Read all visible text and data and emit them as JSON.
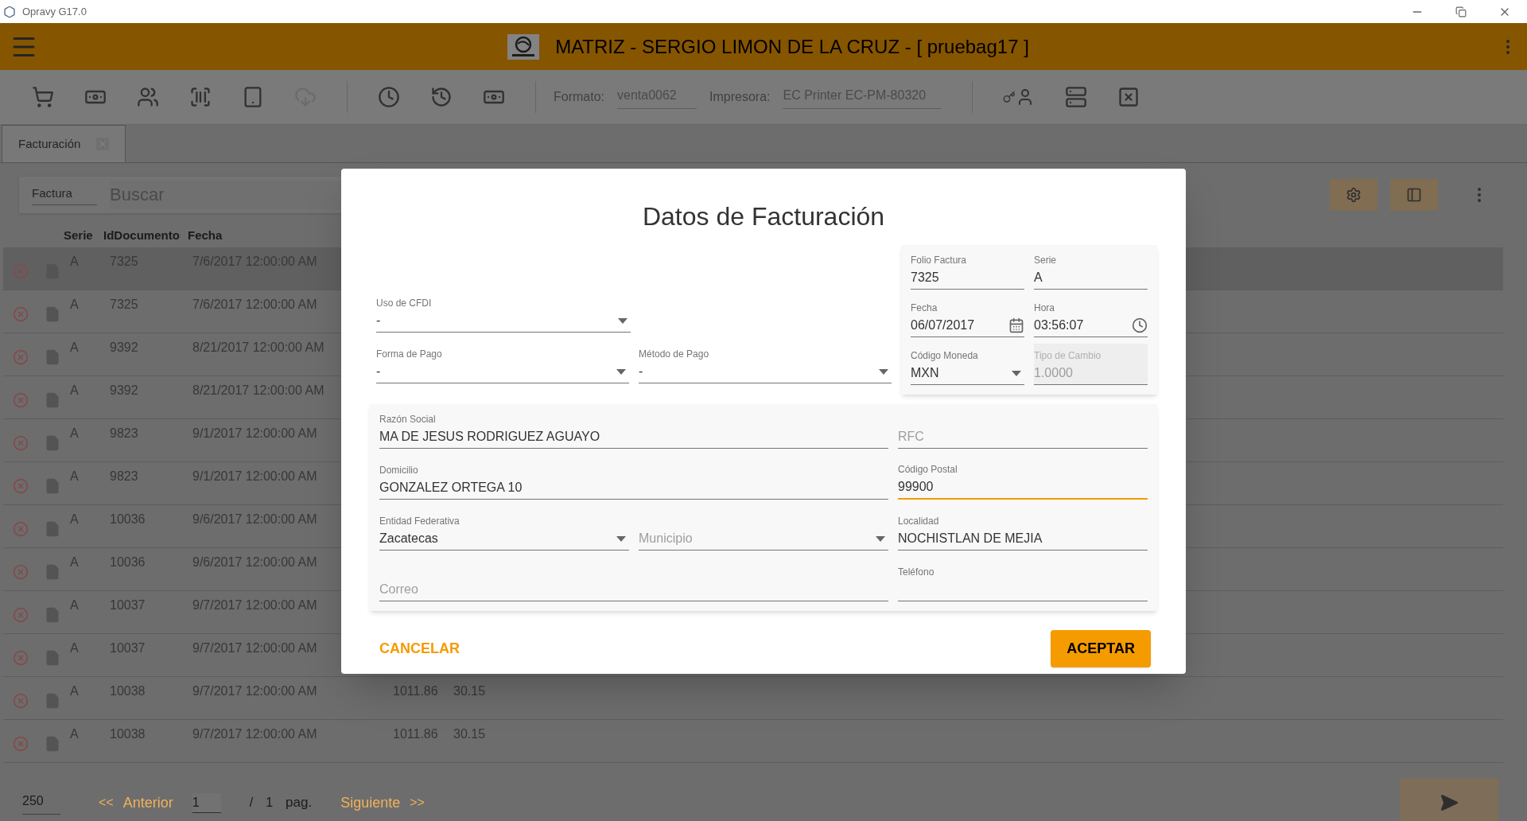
{
  "window": {
    "title": "Opravy G17.0"
  },
  "header": {
    "title": "MATRIZ - SERGIO LIMON DE LA CRUZ - [ pruebag17 ]"
  },
  "toolbar": {
    "icons": [
      {
        "kind": "cart",
        "disabled": false
      },
      {
        "kind": "cash",
        "disabled": false
      },
      {
        "kind": "people",
        "disabled": false
      },
      {
        "kind": "barcode",
        "disabled": false
      },
      {
        "kind": "tablet",
        "disabled": false
      },
      {
        "kind": "cloud",
        "disabled": true
      },
      {
        "kind": "clock",
        "disabled": false
      },
      {
        "kind": "history",
        "disabled": false
      },
      {
        "kind": "cash",
        "disabled": false
      }
    ],
    "format_label": "Formato:",
    "format_value": "venta0062",
    "printer_label": "Impresora:",
    "printer_value": "EC Printer EC-PM-80320",
    "right_icons": [
      {
        "kind": "user-key"
      },
      {
        "kind": "server"
      },
      {
        "kind": "close"
      }
    ]
  },
  "tabs": [
    {
      "label": "Facturación",
      "selected": true
    }
  ],
  "search": {
    "type": "Factura",
    "placeholder": "Buscar"
  },
  "table": {
    "columns": [
      "Serie",
      "IdDocumento",
      "Fecha"
    ],
    "rows": [
      {
        "serie": "A",
        "id": "7325",
        "fecha": "7/6/2017 12:00:00 AM",
        "selected": true
      },
      {
        "serie": "A",
        "id": "7325",
        "fecha": "7/6/2017 12:00:00 AM",
        "selected": false
      },
      {
        "serie": "A",
        "id": "9392",
        "fecha": "8/21/2017 12:00:00 AM",
        "selected": false
      },
      {
        "serie": "A",
        "id": "9392",
        "fecha": "8/21/2017 12:00:00 AM",
        "selected": false
      },
      {
        "serie": "A",
        "id": "9823",
        "fecha": "9/1/2017 12:00:00 AM",
        "selected": false
      },
      {
        "serie": "A",
        "id": "9823",
        "fecha": "9/1/2017 12:00:00 AM",
        "selected": false
      },
      {
        "serie": "A",
        "id": "10036",
        "fecha": "9/6/2017 12:00:00 AM",
        "selected": false
      },
      {
        "serie": "A",
        "id": "10036",
        "fecha": "9/6/2017 12:00:00 AM",
        "selected": false
      },
      {
        "serie": "A",
        "id": "10037",
        "fecha": "9/7/2017 12:00:00 AM",
        "selected": false
      },
      {
        "serie": "A",
        "id": "10037",
        "fecha": "9/7/2017 12:00:00 AM",
        "selected": false
      },
      {
        "serie": "A",
        "id": "10038",
        "fecha": "9/7/2017 12:00:00 AM",
        "column_4": "1011.86",
        "column_5": "30.15",
        "selected": false
      },
      {
        "serie": "A",
        "id": "10038",
        "fecha": "9/7/2017 12:00:00 AM",
        "column_4": "1011.86",
        "column_5": "30.15",
        "selected": false
      }
    ]
  },
  "pagination": {
    "page_size": "250",
    "prev_arrows": "<<",
    "prev": "Anterior",
    "page": "1",
    "slash": "/",
    "total": "1",
    "pag": "pag.",
    "next": "Siguiente",
    "next_arrows": ">>"
  },
  "dialog": {
    "title": "Datos de Facturación",
    "summary": [
      {
        "kind": "text",
        "label": "Folio Factura",
        "value": "7325"
      },
      {
        "kind": "text",
        "label": "Serie",
        "value": "A"
      },
      {
        "kind": "date",
        "label": "Fecha",
        "value": "06/07/2017"
      },
      {
        "kind": "time",
        "label": "Hora",
        "value": "03:56:07"
      },
      {
        "kind": "select",
        "label": "Código Moneda",
        "value": "MXN"
      },
      {
        "kind": "text",
        "label": "Tipo de Cambio",
        "value": "1.0000",
        "disabled": true
      }
    ],
    "uso_cfdi": {
      "kind": "select",
      "label": "Uso de CFDI",
      "value": "-"
    },
    "payment": [
      {
        "kind": "select",
        "label": "Forma de Pago",
        "value": "-"
      },
      {
        "kind": "select",
        "label": "Método de Pago",
        "value": "-"
      }
    ],
    "customer": [
      [
        {
          "kind": "text",
          "label": "Razón Social",
          "value": "MA DE JESUS RODRIGUEZ AGUAYO"
        },
        {
          "kind": "text",
          "placeholder": "RFC"
        }
      ],
      [
        {
          "kind": "text",
          "label": "Domicilio",
          "value": "GONZALEZ ORTEGA 10"
        },
        {
          "kind": "text",
          "label": "Código Postal",
          "value": "99900",
          "focused": true
        }
      ],
      [
        {
          "kind": "select",
          "label": "Entidad Federativa",
          "value": "Zacatecas"
        },
        {
          "kind": "select",
          "placeholder": "Municipio"
        },
        {
          "kind": "text",
          "label": "Localidad",
          "value": "NOCHISTLAN DE MEJIA"
        }
      ],
      [
        {
          "kind": "text",
          "placeholder": "Correo"
        },
        {
          "kind": "text",
          "label": "Teléfono"
        }
      ]
    ],
    "cancel": "CANCELAR",
    "accept": "ACEPTAR"
  }
}
